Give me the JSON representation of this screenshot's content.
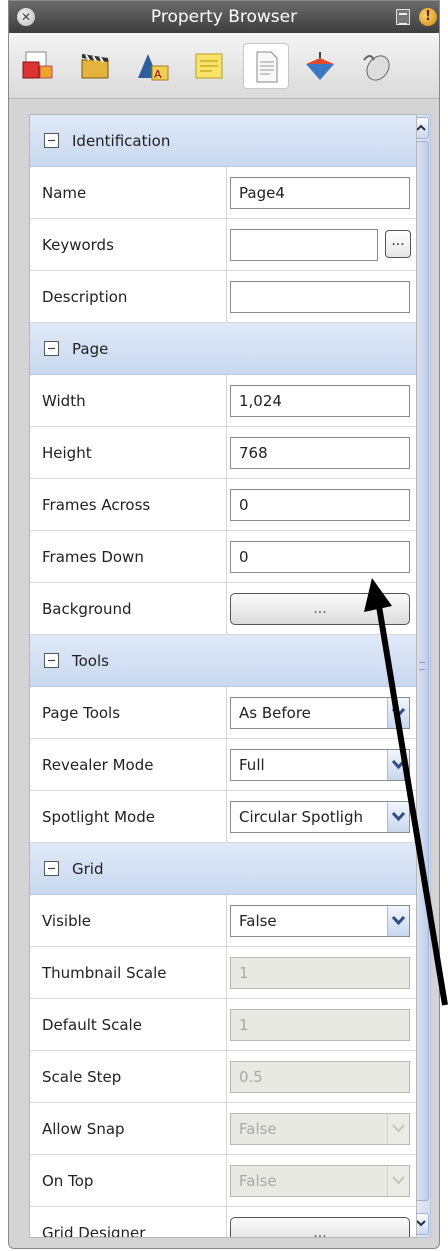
{
  "window": {
    "title": "Property Browser"
  },
  "toolbar": {
    "tools": [
      {
        "icon": "properties-icon"
      },
      {
        "icon": "clapperboard-icon"
      },
      {
        "icon": "text-effects-icon"
      },
      {
        "icon": "sticky-notes-icon"
      },
      {
        "icon": "page-document-icon",
        "active": true
      },
      {
        "icon": "spinning-top-icon"
      },
      {
        "icon": "mouse-icon"
      }
    ]
  },
  "groups": {
    "identification": {
      "title": "Identification",
      "name_label": "Name",
      "name_value": "Page4",
      "keywords_label": "Keywords",
      "keywords_value": "",
      "keywords_button": "...",
      "description_label": "Description",
      "description_value": ""
    },
    "page": {
      "title": "Page",
      "width_label": "Width",
      "width_value": "1,024",
      "height_label": "Height",
      "height_value": "768",
      "frames_across_label": "Frames Across",
      "frames_across_value": "0",
      "frames_down_label": "Frames Down",
      "frames_down_value": "0",
      "background_label": "Background",
      "background_button": "..."
    },
    "tools": {
      "title": "Tools",
      "page_tools_label": "Page Tools",
      "page_tools_value": "As Before",
      "revealer_mode_label": "Revealer Mode",
      "revealer_mode_value": "Full",
      "spotlight_mode_label": "Spotlight Mode",
      "spotlight_mode_value": "Circular Spotligh"
    },
    "grid": {
      "title": "Grid",
      "visible_label": "Visible",
      "visible_value": "False",
      "thumbnail_scale_label": "Thumbnail Scale",
      "thumbnail_scale_value": "1",
      "default_scale_label": "Default Scale",
      "default_scale_value": "1",
      "scale_step_label": "Scale Step",
      "scale_step_value": "0.5",
      "allow_snap_label": "Allow Snap",
      "allow_snap_value": "False",
      "on_top_label": "On Top",
      "on_top_value": "False",
      "grid_designer_label": "Grid Designer",
      "grid_designer_button": "..."
    }
  },
  "colors": {
    "group_header": "#c9d8f0",
    "disabled_field": "#e9e9e3",
    "annotation_arrow": "#000000"
  }
}
